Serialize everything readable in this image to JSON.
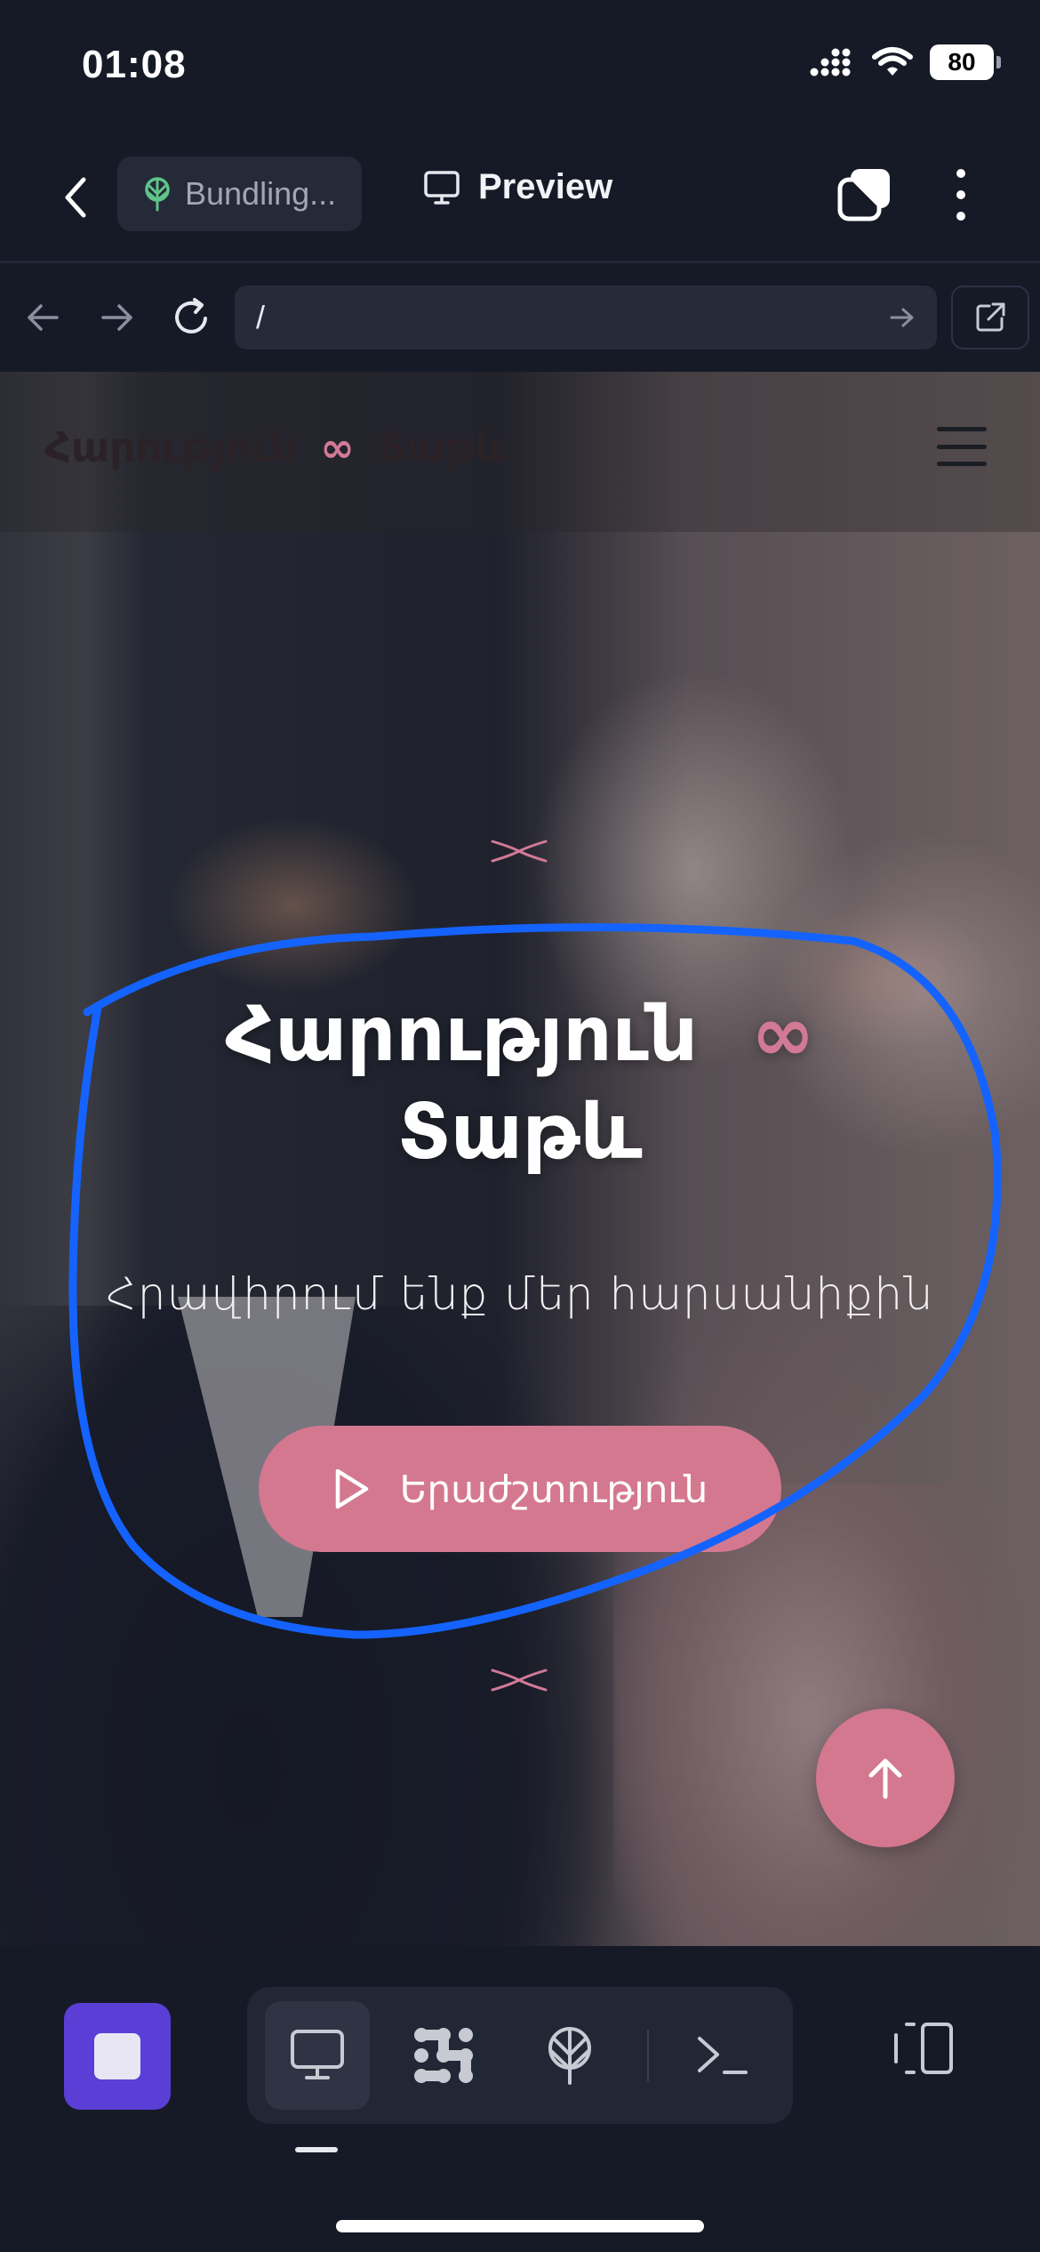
{
  "status_bar": {
    "time": "01:08",
    "battery": "80"
  },
  "toolbar": {
    "bundling_label": "Bundling...",
    "preview_label": "Preview"
  },
  "url_bar": {
    "url": "/"
  },
  "site": {
    "logo_left": "Հարություն",
    "logo_symbol": "∞",
    "logo_right": "Տաթև",
    "hero_title_line1": "Հարություն",
    "hero_title_symbol": "∞",
    "hero_title_line2": "Տաթև",
    "hero_subtitle": "Հրավիրում ենք մեր հարսանիքին",
    "music_button_label": "Երաժշտություն",
    "accent_color": "#d4788f"
  },
  "dock": {
    "items": [
      "desktop-preview",
      "layout-grid",
      "deploy",
      "terminal"
    ],
    "active_item": "desktop-preview",
    "stop_color": "#5b3ed6"
  },
  "annotation": {
    "color": "#1463ff"
  }
}
